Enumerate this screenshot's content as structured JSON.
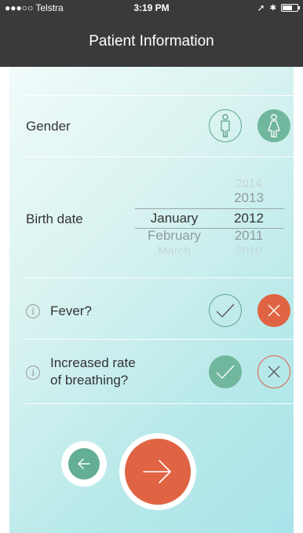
{
  "status_bar": {
    "carrier": "●●●○○ Telstra",
    "time": "3:19 PM"
  },
  "header": {
    "title": "Patient Information"
  },
  "form": {
    "gender": {
      "label": "Gender",
      "options": [
        {
          "icon": "male-icon",
          "selected": false
        },
        {
          "icon": "female-icon",
          "selected": true
        }
      ]
    },
    "birth_date": {
      "label": "Birth date",
      "months": [
        "January",
        "February",
        "March"
      ],
      "selected_month": "January",
      "years": [
        "2014",
        "2013",
        "2012",
        "2011",
        "2010"
      ],
      "selected_year": "2012"
    },
    "fever": {
      "label": "Fever?",
      "answer": "no"
    },
    "breathing": {
      "label_line1": "Increased rate",
      "label_line2": "of breathing?",
      "answer": "yes"
    }
  },
  "colors": {
    "header_bg": "#3a3a3a",
    "green": "#71b79d",
    "red": "#e06443"
  }
}
